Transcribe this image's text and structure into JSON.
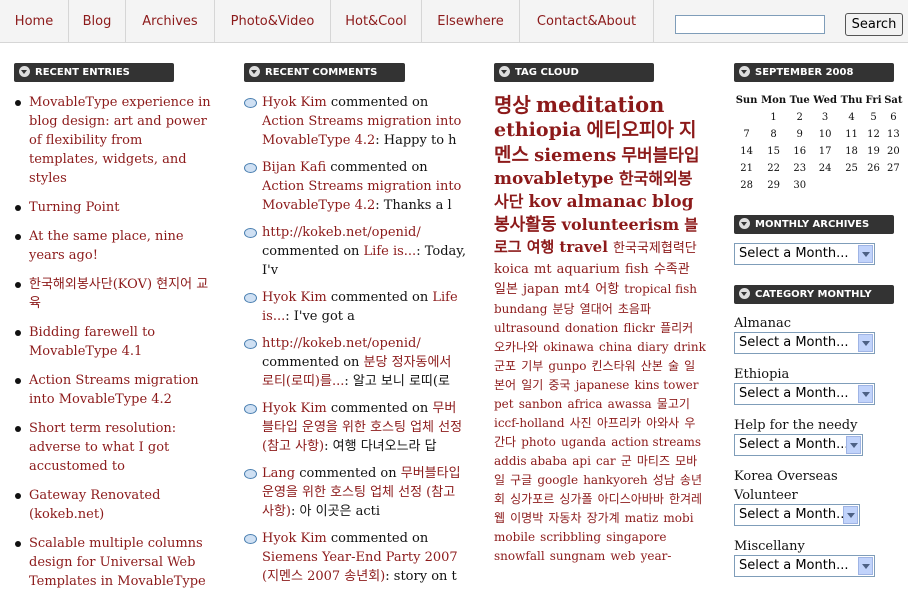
{
  "nav": {
    "items": [
      "Home",
      "Blog",
      "Archives",
      "Photo&Video",
      "Hot&Cool",
      "Elsewhere",
      "Contact&About"
    ],
    "search_button": "Search"
  },
  "recent_entries": {
    "heading": "RECENT ENTRIES",
    "items": [
      "MovableType experience in blog design: art and power of flexibility from templates, widgets, and styles",
      "Turning Point",
      "At the same place, nine years ago!",
      "한국해외봉사단(KOV) 현지어 교육",
      "Bidding farewell to MovableType 4.1",
      "Action Streams migration into MovableType 4.2",
      "Short term resolution: adverse to what I got accustomed to",
      "Gateway Renovated (kokeb.net)",
      "Scalable multiple columns design for Universal Web Templates in MovableType"
    ]
  },
  "recent_comments": {
    "heading": "RECENT COMMENTS",
    "items": [
      {
        "author": "Hyok Kim",
        "verb": " commented on ",
        "post": "Action Streams migration into MovableType 4.2",
        "excerpt": ": Happy to h"
      },
      {
        "author": "Bijan Kafi",
        "verb": " commented on ",
        "post": "Action Streams migration into MovableType 4.2",
        "excerpt": ": Thanks a l"
      },
      {
        "author": "http://kokeb.net/openid/",
        "verb": " commented on ",
        "post": "Life is...",
        "excerpt": ": Today, I'v"
      },
      {
        "author": "Hyok Kim",
        "verb": " commented on ",
        "post": "Life is...",
        "excerpt": ": I've got a"
      },
      {
        "author": "http://kokeb.net/openid/",
        "verb": " commented on ",
        "post": "분당 정자동에서 로티(로띠)를...",
        "excerpt": ": 알고 보니 로띠(로"
      },
      {
        "author": "Hyok Kim",
        "verb": " commented on ",
        "post": "무버블타입 운영을 위한 호스팅 업체 선정 (참고 사항)",
        "excerpt": ": 여행 다녀오느라 답"
      },
      {
        "author": "Lang",
        "verb": " commented on ",
        "post": "무버블타입 운영을 위한 호스팅 업체 선정 (참고 사항)",
        "excerpt": ": 아 이곳은 acti"
      },
      {
        "author": "Hyok Kim",
        "verb": " commented on ",
        "post": "Siemens Year-End Party 2007 (지멘스 2007 송년회)",
        "excerpt": ": story on t"
      }
    ]
  },
  "tag_cloud": {
    "heading": "TAG CLOUD",
    "tags": [
      {
        "t": "명상",
        "s": 20
      },
      {
        "t": "meditation",
        "s": 21
      },
      {
        "t": "ethiopia",
        "s": 19
      },
      {
        "t": "에티오피아",
        "s": 19
      },
      {
        "t": "지멘스",
        "s": 19
      },
      {
        "t": "siemens",
        "s": 18
      },
      {
        "t": "무버블타입",
        "s": 17
      },
      {
        "t": "movabletype",
        "s": 17
      },
      {
        "t": "한국해외봉사단",
        "s": 16
      },
      {
        "t": "kov",
        "s": 17
      },
      {
        "t": "almanac",
        "s": 17
      },
      {
        "t": "blog",
        "s": 17
      },
      {
        "t": "봉사활동",
        "s": 17
      },
      {
        "t": "volunteerism",
        "s": 16
      },
      {
        "t": "블로그",
        "s": 15
      },
      {
        "t": "여행",
        "s": 15
      },
      {
        "t": "travel",
        "s": 15
      },
      {
        "t": "한국국제협력단",
        "s": 13
      },
      {
        "t": "koica",
        "s": 13
      },
      {
        "t": "mt",
        "s": 13
      },
      {
        "t": "aquarium",
        "s": 13
      },
      {
        "t": "fish",
        "s": 13
      },
      {
        "t": "수족관",
        "s": 13
      },
      {
        "t": "일본",
        "s": 13
      },
      {
        "t": "japan",
        "s": 13
      },
      {
        "t": "mt4",
        "s": 13
      },
      {
        "t": "어항",
        "s": 13
      },
      {
        "t": "tropical fish",
        "s": 12
      },
      {
        "t": "bundang",
        "s": 12
      },
      {
        "t": "분당",
        "s": 12
      },
      {
        "t": "열대어",
        "s": 12
      },
      {
        "t": "초음파",
        "s": 12
      },
      {
        "t": "ultrasound",
        "s": 12
      },
      {
        "t": "donation",
        "s": 12
      },
      {
        "t": "flickr",
        "s": 12
      },
      {
        "t": "플리커",
        "s": 12
      },
      {
        "t": "오카나와",
        "s": 12
      },
      {
        "t": "okinawa",
        "s": 12
      },
      {
        "t": "china",
        "s": 12
      },
      {
        "t": "diary",
        "s": 12
      },
      {
        "t": "drink",
        "s": 12
      },
      {
        "t": "군포",
        "s": 12
      },
      {
        "t": "기부",
        "s": 12
      },
      {
        "t": "gunpo",
        "s": 12
      },
      {
        "t": "킨스타워",
        "s": 12
      },
      {
        "t": "산본",
        "s": 12
      },
      {
        "t": "술",
        "s": 12
      },
      {
        "t": "일본어",
        "s": 12
      },
      {
        "t": "일기",
        "s": 12
      },
      {
        "t": "중국",
        "s": 12
      },
      {
        "t": "japanese",
        "s": 12
      },
      {
        "t": "kins tower",
        "s": 12
      },
      {
        "t": "pet",
        "s": 12
      },
      {
        "t": "sanbon",
        "s": 12
      },
      {
        "t": "africa",
        "s": 12
      },
      {
        "t": "awassa",
        "s": 12
      },
      {
        "t": "물고기",
        "s": 12
      },
      {
        "t": "iccf-holland",
        "s": 12
      },
      {
        "t": "사진",
        "s": 12
      },
      {
        "t": "아프리카",
        "s": 12
      },
      {
        "t": "아와사",
        "s": 12
      },
      {
        "t": "우간다",
        "s": 12
      },
      {
        "t": "photo",
        "s": 12
      },
      {
        "t": "uganda",
        "s": 12
      },
      {
        "t": "action streams",
        "s": 12
      },
      {
        "t": "addis ababa",
        "s": 12
      },
      {
        "t": "api",
        "s": 12
      },
      {
        "t": "car",
        "s": 12
      },
      {
        "t": "군",
        "s": 12
      },
      {
        "t": "마티즈",
        "s": 12
      },
      {
        "t": "모바일",
        "s": 12
      },
      {
        "t": "구글",
        "s": 12
      },
      {
        "t": "google",
        "s": 12
      },
      {
        "t": "hankyoreh",
        "s": 12
      },
      {
        "t": "성남",
        "s": 12
      },
      {
        "t": "송년회",
        "s": 12
      },
      {
        "t": "싱가포르",
        "s": 12
      },
      {
        "t": "싱가폴",
        "s": 12
      },
      {
        "t": "아디스아바바",
        "s": 12
      },
      {
        "t": "한겨레",
        "s": 12
      },
      {
        "t": "웹",
        "s": 12
      },
      {
        "t": "이명박",
        "s": 12
      },
      {
        "t": "자동차",
        "s": 12
      },
      {
        "t": "장가계",
        "s": 12
      },
      {
        "t": "matiz",
        "s": 12
      },
      {
        "t": "mobi",
        "s": 12
      },
      {
        "t": "mobile",
        "s": 12
      },
      {
        "t": "scribbling",
        "s": 12
      },
      {
        "t": "singapore",
        "s": 12
      },
      {
        "t": "snowfall",
        "s": 12
      },
      {
        "t": "sungnam",
        "s": 12
      },
      {
        "t": "web",
        "s": 12
      },
      {
        "t": "year-",
        "s": 12
      }
    ]
  },
  "calendar": {
    "heading": "SEPTEMBER 2008",
    "weekdays": [
      "Sun",
      "Mon",
      "Tue",
      "Wed",
      "Thu",
      "Fri",
      "Sat"
    ],
    "weeks": [
      [
        "",
        "1",
        "2",
        "3",
        "4",
        "5",
        "6"
      ],
      [
        "7",
        "8",
        "9",
        "10",
        "11",
        "12",
        "13"
      ],
      [
        "14",
        "15",
        "16",
        "17",
        "18",
        "19",
        "20"
      ],
      [
        "21",
        "22",
        "23",
        "24",
        "25",
        "26",
        "27"
      ],
      [
        "28",
        "29",
        "30",
        "",
        "",
        "",
        ""
      ]
    ]
  },
  "monthly_archives": {
    "heading": "MONTHLY ARCHIVES",
    "select": "Select a Month..."
  },
  "category_monthly": {
    "heading": "CATEGORY MONTHLY",
    "categories": [
      {
        "label": "Almanac",
        "select": "Select a Month..."
      },
      {
        "label": "Ethiopia",
        "select": "Select a Month..."
      },
      {
        "label": "Help for the needy",
        "select": "Select a Month..."
      },
      {
        "label": "Korea Overseas Volunteer",
        "select": "Select a Month..."
      },
      {
        "label": "Miscellany",
        "select": "Select a Month..."
      }
    ]
  },
  "colors": {
    "link": "#8c1a1a",
    "header_bg": "#333333",
    "nav_bg": "#f4f4f4"
  }
}
